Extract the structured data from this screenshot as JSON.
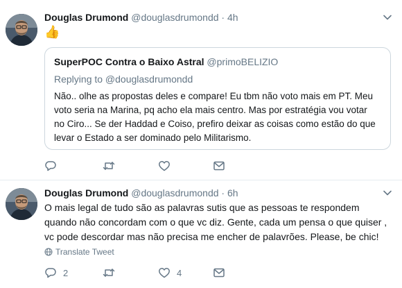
{
  "tweets": [
    {
      "author_name": "Douglas Drumond",
      "author_handle": "@douglasdrumondd",
      "separator": "·",
      "time": "4h",
      "emoji": "👍",
      "quoted": {
        "name": "SuperPOC Contra o Baixo Astral",
        "handle": "@primoBELIZIO",
        "replying_to": "Replying to @douglasdrumondd",
        "text": "Não..  olhe as propostas deles e compare! Eu tbm não voto mais em PT. Meu voto seria na Marina, pq acho ela mais centro. Mas por estratégia vou votar no Ciro... Se der Haddad e Coiso, prefiro deixar as coisas como estão do que levar o  Estado a ser dominado pelo Militarismo."
      },
      "counts": {
        "reply": "",
        "retweet": "",
        "like": ""
      }
    },
    {
      "author_name": "Douglas Drumond",
      "author_handle": "@douglasdrumondd",
      "separator": "·",
      "time": "6h",
      "text": "O mais legal de tudo são as palavras sutis que as pessoas te respondem quando não concordam com o que vc diz. Gente, cada um pensa o que quiser , vc pode descordar mas não precisa me encher de palavrões. Please, be chic!",
      "translate_label": "Translate Tweet",
      "counts": {
        "reply": "2",
        "retweet": "",
        "like": "4"
      }
    }
  ],
  "icons": {
    "reply": "reply-icon",
    "retweet": "retweet-icon",
    "like": "heart-icon",
    "dm": "envelope-icon",
    "more": "chevron-down-icon",
    "translate": "globe-icon"
  },
  "colors": {
    "text": "#14171a",
    "secondary": "#657786",
    "border": "#e6ecf0",
    "quote_border": "#ccd6dd"
  }
}
